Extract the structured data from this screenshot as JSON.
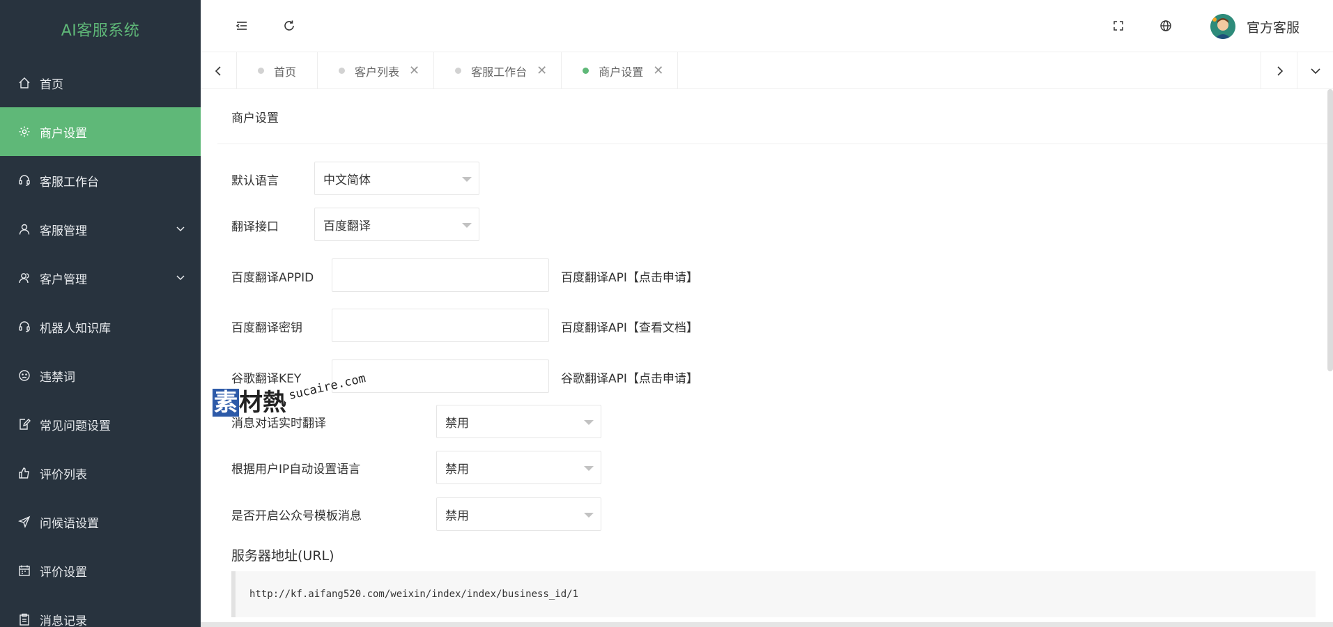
{
  "app": {
    "title": "AI客服系统"
  },
  "sidebar": {
    "items": [
      {
        "label": "首页",
        "icon": "home-icon"
      },
      {
        "label": "商户设置",
        "icon": "gear-icon",
        "active": true
      },
      {
        "label": "客服工作台",
        "icon": "headset-icon"
      },
      {
        "label": "客服管理",
        "icon": "user-icon",
        "expandable": true
      },
      {
        "label": "客户管理",
        "icon": "users-icon",
        "expandable": true
      },
      {
        "label": "机器人知识库",
        "icon": "headset-icon"
      },
      {
        "label": "违禁词",
        "icon": "face-icon"
      },
      {
        "label": "常见问题设置",
        "icon": "edit-icon"
      },
      {
        "label": "评价列表",
        "icon": "thumb-icon"
      },
      {
        "label": "问候语设置",
        "icon": "send-icon"
      },
      {
        "label": "评价设置",
        "icon": "calendar-icon"
      },
      {
        "label": "消息记录",
        "icon": "clipboard-icon"
      }
    ]
  },
  "header": {
    "user_name": "官方客服"
  },
  "tabs": [
    {
      "label": "首页",
      "closable": false,
      "active": false
    },
    {
      "label": "客户列表",
      "closable": true,
      "active": false
    },
    {
      "label": "客服工作台",
      "closable": true,
      "active": false
    },
    {
      "label": "商户设置",
      "closable": true,
      "active": true
    }
  ],
  "close_symbol": "✕",
  "page": {
    "title": "商户设置",
    "default_language": {
      "label": "默认语言",
      "value": "中文简体"
    },
    "translate_api": {
      "label": "翻译接口",
      "value": "百度翻译"
    },
    "baidu_appid": {
      "label": "百度翻译APPID",
      "value": "",
      "hint": "百度翻译API【点击申请】"
    },
    "baidu_secret": {
      "label": "百度翻译密钥",
      "value": "",
      "hint": "百度翻译API【查看文档】"
    },
    "google_key": {
      "label": "谷歌翻译KEY",
      "value": "",
      "hint": "谷歌翻译API【点击申请】"
    },
    "realtime_translate": {
      "label": "消息对话实时翻译",
      "value": "禁用"
    },
    "ip_language": {
      "label": "根据用户IP自动设置语言",
      "value": "禁用"
    },
    "wechat_template": {
      "label": "是否开启公众号模板消息",
      "value": "禁用"
    },
    "server_url": {
      "label": "服务器地址(URL)",
      "value": "http://kf.aifang520.com/weixin/index/index/business_id/1"
    }
  },
  "watermark": {
    "cn_first": "素",
    "cn_rest": "材熱",
    "en": "sucaire.com"
  },
  "colors": {
    "sidebar_bg": "#28333e",
    "accent": "#5fb878"
  }
}
